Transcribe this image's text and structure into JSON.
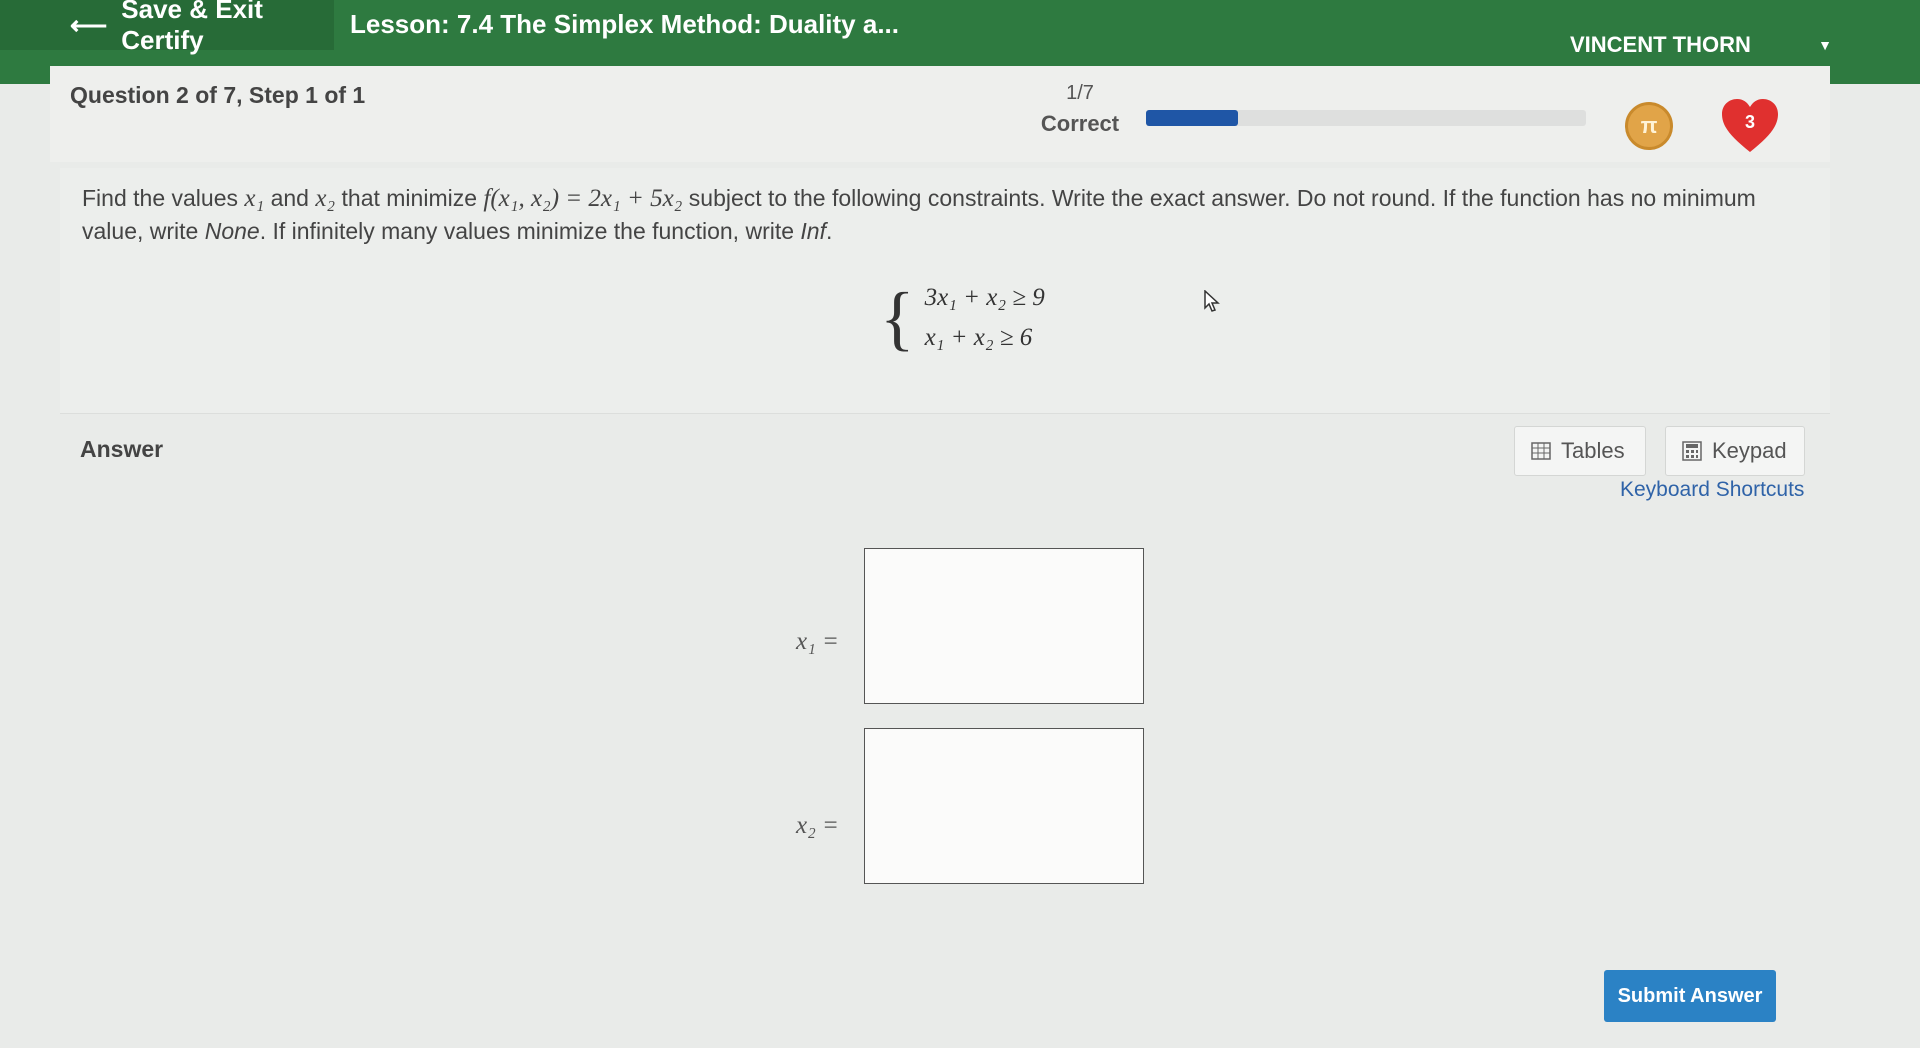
{
  "header": {
    "save_exit_label": "Save & Exit Certify",
    "lesson_title": "Lesson: 7.4 The Simplex Method: Duality a...",
    "user_name": "VINCENT THORN"
  },
  "status": {
    "question_label": "Question 2 of 7, Step 1 of 1",
    "score_fraction": "1/7",
    "score_state": "Correct",
    "progress_fraction": 0.21,
    "coin_symbol": "π",
    "hearts_count": "3",
    "colors": {
      "progress": "#1f56a6",
      "coin": "#e1a448",
      "heart": "#e0302f",
      "topbar": "#2e7a40"
    }
  },
  "question": {
    "intro": "Find the values",
    "x1": "x₁",
    "and_word": "and",
    "x2": "x₂",
    "that_minimize": "that minimize",
    "function": "f(x₁, x₂) = 2x₁ + 5x₂",
    "rest_1": "subject to the following constraints. Write the exact answer. Do not round. If the function has no minimum value, write",
    "none_word": "None",
    "rest_2": ". If infinitely many values minimize the function, write",
    "inf_word": "Inf",
    "end": ".",
    "constraints": [
      "3x₁ + x₂  ≥ 9",
      "x₁ + x₂  ≥ 6"
    ]
  },
  "answer": {
    "label": "Answer",
    "tables_label": "Tables",
    "keypad_label": "Keypad",
    "shortcuts_label": "Keyboard Shortcuts",
    "x1_label": "x₁ =",
    "x2_label": "x₂ =",
    "x1_value": "",
    "x2_value": "",
    "submit_label": "Submit Answer"
  }
}
